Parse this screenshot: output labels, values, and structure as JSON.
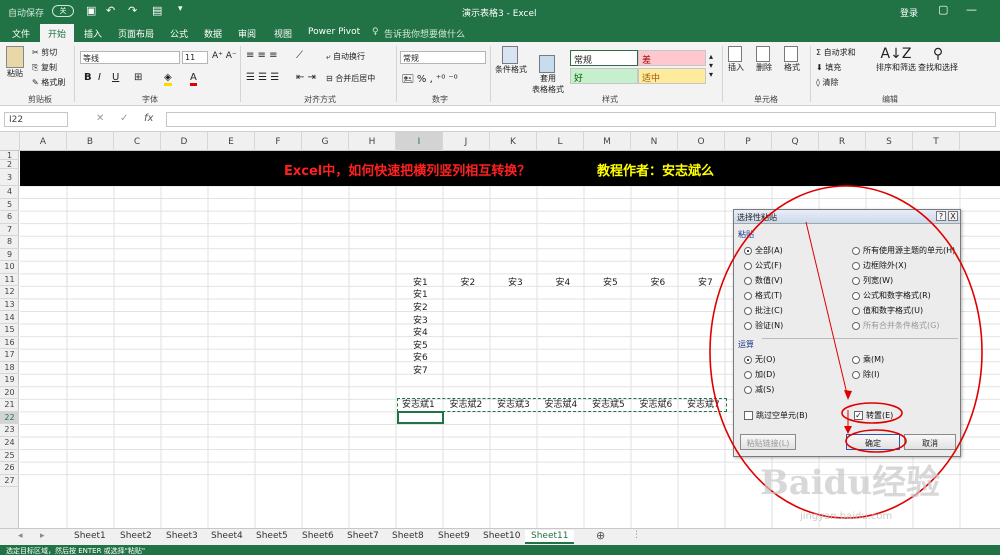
{
  "titlebar": {
    "autosave": "自动保存",
    "autosave_state": "关",
    "title": "演示表格3  -  Excel",
    "login": "登录"
  },
  "tabs": [
    "文件",
    "开始",
    "插入",
    "页面布局",
    "公式",
    "数据",
    "审阅",
    "视图",
    "Power Pivot"
  ],
  "active_tab": "开始",
  "tell_me": "告诉我你想要做什么",
  "ribbon": {
    "clipboard": {
      "paste": "粘贴",
      "cut": "剪切",
      "copy": "复制",
      "format_painter": "格式刷",
      "group": "剪贴板"
    },
    "font": {
      "name": "等线",
      "size": "11",
      "group": "字体"
    },
    "alignment": {
      "wrap": "自动换行",
      "merge": "合并后居中",
      "group": "对齐方式"
    },
    "number": {
      "format": "常规",
      "group": "数字"
    },
    "styles": {
      "cond": "条件格式",
      "table": "套用\n表格格式",
      "normal": "常规",
      "bad": "差",
      "good": "好",
      "neutral": "适中",
      "group": "样式"
    },
    "cells": {
      "insert": "插入",
      "delete": "删除",
      "format": "格式",
      "group": "单元格"
    },
    "editing": {
      "autosum": "自动求和",
      "fill": "填充",
      "clear": "清除",
      "sort": "排序和筛选",
      "find": "查找和选择",
      "group": "编辑"
    }
  },
  "namebox": "I22",
  "fx": "fx",
  "columns": [
    "A",
    "B",
    "C",
    "D",
    "E",
    "F",
    "G",
    "H",
    "I",
    "J",
    "K",
    "L",
    "M",
    "N",
    "O",
    "P",
    "Q",
    "R",
    "S",
    "T"
  ],
  "active_column": "I",
  "rows": [
    "1",
    "2",
    "3",
    "4",
    "5",
    "6",
    "7",
    "8",
    "9",
    "10",
    "11",
    "12",
    "13",
    "14",
    "15",
    "16",
    "17",
    "18",
    "19",
    "20",
    "21",
    "22",
    "23",
    "24",
    "25",
    "26",
    "27"
  ],
  "active_row": "22",
  "banner": {
    "left": "Excel中，如何快速把横列竖列相互转换？",
    "right": "教程作者：安志斌么"
  },
  "row11": [
    "安1",
    "安2",
    "安3",
    "安4",
    "安5",
    "安6",
    "安7"
  ],
  "col_i": [
    "安1",
    "安2",
    "安3",
    "安4",
    "安5",
    "安6",
    "安7"
  ],
  "row21": [
    "安志斌1",
    "安志斌2",
    "安志斌3",
    "安志斌4",
    "安志斌5",
    "安志斌6",
    "安志斌7"
  ],
  "dialog": {
    "title": "选择性粘贴",
    "help": "?",
    "close": "X",
    "paste_label": "粘贴",
    "paste_left": [
      {
        "label": "全部(A)",
        "on": true
      },
      {
        "label": "公式(F)",
        "on": false
      },
      {
        "label": "数值(V)",
        "on": false
      },
      {
        "label": "格式(T)",
        "on": false
      },
      {
        "label": "批注(C)",
        "on": false
      },
      {
        "label": "验证(N)",
        "on": false
      }
    ],
    "paste_right": [
      {
        "label": "所有使用源主题的单元(H)",
        "on": false
      },
      {
        "label": "边框除外(X)",
        "on": false
      },
      {
        "label": "列宽(W)",
        "on": false
      },
      {
        "label": "公式和数字格式(R)",
        "on": false
      },
      {
        "label": "值和数字格式(U)",
        "on": false
      },
      {
        "label": "所有合并条件格式(G)",
        "on": false
      }
    ],
    "op_label": "运算",
    "op_left": [
      {
        "label": "无(O)",
        "on": true
      },
      {
        "label": "加(D)",
        "on": false
      },
      {
        "label": "减(S)",
        "on": false
      }
    ],
    "op_right": [
      {
        "label": "乘(M)",
        "on": false
      },
      {
        "label": "除(I)",
        "on": false
      }
    ],
    "skip_blanks": "跳过空单元(B)",
    "transpose": "转置(E)",
    "paste_link": "粘贴链接(L)",
    "ok": "确定",
    "cancel": "取消"
  },
  "sheets": [
    "Sheet1",
    "Sheet2",
    "Sheet3",
    "Sheet4",
    "Sheet5",
    "Sheet6",
    "Sheet7",
    "Sheet8",
    "Sheet9",
    "Sheet10",
    "Sheet11"
  ],
  "active_sheet": "Sheet11",
  "status": "选定目标区域，然后按 ENTER 或选择\"粘贴\"",
  "watermark": "Baidu经验",
  "watermark_url": "jingyan.baidu.com",
  "colors": {
    "excel_green": "#217346",
    "annotation_red": "#e00000",
    "banner_text_red": "#ff2020",
    "banner_text_yellow": "#ffff00"
  }
}
